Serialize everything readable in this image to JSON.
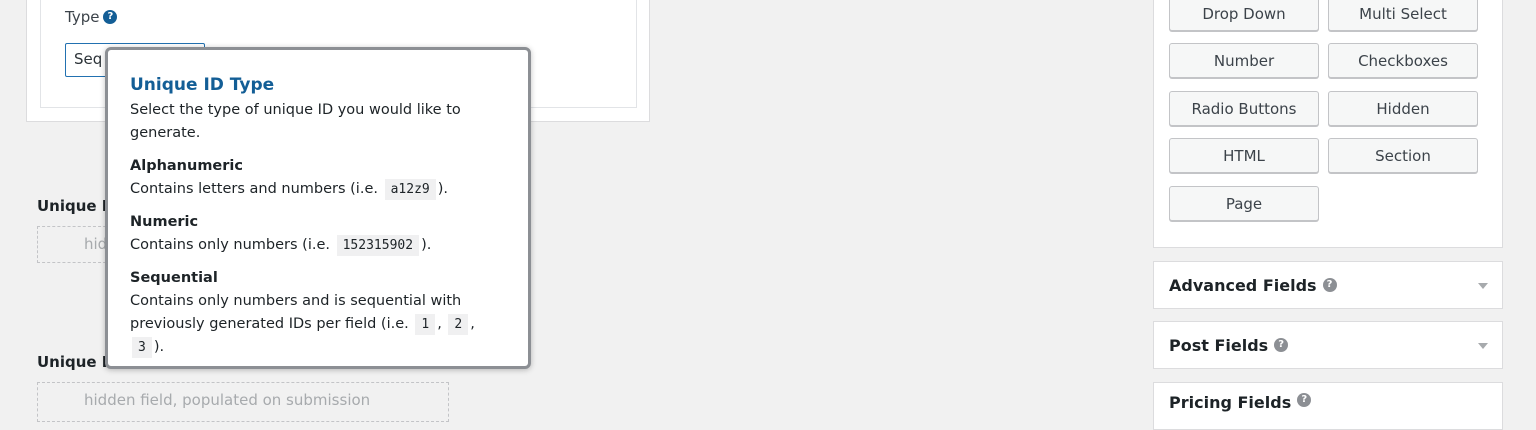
{
  "type_setting": {
    "label": "Type",
    "help_icon": "question-circle-icon",
    "selected_value": "Seq"
  },
  "fields_preview": [
    {
      "title": "Unique I",
      "placeholder": "hid"
    },
    {
      "title": "Unique I",
      "placeholder": "hidden field, populated on submission"
    }
  ],
  "tooltip": {
    "title": "Unique ID Type",
    "intro": "Select the type of unique ID you would like to generate.",
    "sections": [
      {
        "title": "Alphanumeric",
        "text_before": "Contains letters and numbers (i.e. ",
        "codes": [
          "a12z9"
        ],
        "text_after": ")."
      },
      {
        "title": "Numeric",
        "text_before": "Contains only numbers (i.e. ",
        "codes": [
          "152315902"
        ],
        "text_after": ")."
      },
      {
        "title": "Sequential",
        "text_before": "Contains only numbers and is sequential with previously generated IDs per field (i.e. ",
        "codes": [
          "1",
          "2",
          "3"
        ],
        "text_after": ")."
      }
    ]
  },
  "field_buttons": [
    "Drop Down",
    "Multi Select",
    "Number",
    "Checkboxes",
    "Radio Buttons",
    "Hidden",
    "HTML",
    "Section",
    "Page"
  ],
  "accordions": [
    {
      "label": "Advanced Fields",
      "icon": "question-circle-icon"
    },
    {
      "label": "Post Fields",
      "icon": "question-circle-icon"
    },
    {
      "label": "Pricing Fields",
      "icon": "question-circle-icon"
    }
  ]
}
